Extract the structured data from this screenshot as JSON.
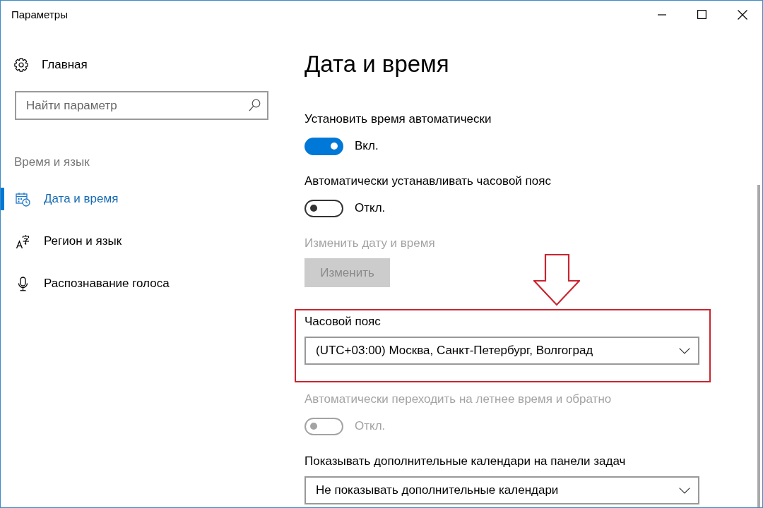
{
  "window": {
    "title": "Параметры"
  },
  "sidebar": {
    "home": {
      "label": "Главная"
    },
    "search": {
      "placeholder": "Найти параметр"
    },
    "section_title": "Время и язык",
    "items": [
      {
        "label": "Дата и время",
        "selected": true
      },
      {
        "label": "Регион и язык",
        "selected": false
      },
      {
        "label": "Распознавание голоса",
        "selected": false
      }
    ]
  },
  "page": {
    "title": "Дата и время",
    "settings": [
      {
        "kind": "toggle",
        "label": "Установить время автоматически",
        "on": true,
        "state_text": "Вкл.",
        "disabled": false,
        "highlighted": false
      },
      {
        "kind": "toggle",
        "label": "Автоматически устанавливать часовой пояс",
        "on": false,
        "state_text": "Откл.",
        "disabled": false,
        "highlighted": false
      },
      {
        "kind": "button",
        "label": "Изменить дату и время",
        "button_label": "Изменить",
        "disabled": true,
        "highlighted": false
      },
      {
        "kind": "dropdown",
        "label": "Часовой пояс",
        "value": "(UTC+03:00) Москва, Санкт-Петербург, Волгоград",
        "disabled": false,
        "highlighted": true
      },
      {
        "kind": "toggle",
        "label": "Автоматически переходить на летнее время и обратно",
        "on": false,
        "state_text": "Откл.",
        "disabled": true,
        "highlighted": false
      },
      {
        "kind": "dropdown",
        "label": "Показывать дополнительные календари на панели задач",
        "value": "Не показывать дополнительные календари",
        "disabled": false,
        "highlighted": false
      }
    ]
  }
}
